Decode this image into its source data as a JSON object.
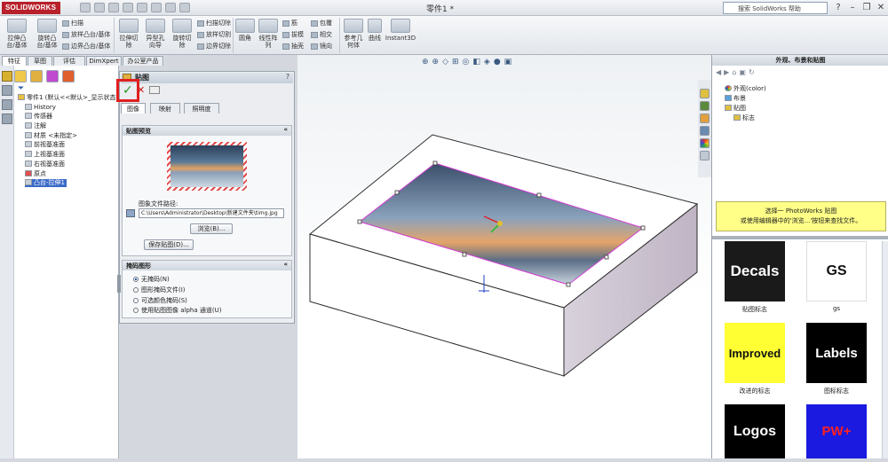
{
  "app": {
    "logo": "SOLIDWORKS",
    "doc_title": "零件1 *",
    "search_placeholder": "搜索 SolidWorks 帮助"
  },
  "ribbon": {
    "extrude_boss": "拉伸凸\n台/基体",
    "revolve_boss": "旋转凸\n台/基体",
    "sweep": "扫描",
    "loft": "放样凸台/基体",
    "boundary_boss": "边界凸台/基体",
    "extrude_cut": "拉伸切\n除",
    "hole_wizard": "异型孔\n向导",
    "revolve_cut": "旋转切\n除",
    "sweep_cut": "扫描切除",
    "loft_cut": "放样切割",
    "boundary_cut": "边界切除",
    "fillet": "圆角",
    "linear_pattern": "线性阵\n列",
    "rib": "筋",
    "draft": "拔模",
    "shell": "抽壳",
    "wrap": "包覆",
    "intersect": "相交",
    "mirror": "镜向",
    "ref_geometry": "参考几\n何体",
    "curves": "曲线",
    "instant3d": "Instant3D"
  },
  "tabs": [
    "特征",
    "草图",
    "评估",
    "DimXpert",
    "办公室产品"
  ],
  "tree": {
    "root": "零件1 (默认<<默认>_显示状态",
    "items": [
      "History",
      "传感器",
      "注解",
      "材质 <未指定>",
      "前视基准面",
      "上视基准面",
      "右视基准面",
      "原点",
      "凸台-拉伸1"
    ]
  },
  "pm": {
    "title": "贴图",
    "tabs": [
      "图像",
      "映射",
      "照明度"
    ],
    "preview_header": "贴图预览",
    "path_label": "图象文件路径:",
    "path_value": "C:\\Users\\Administrator\\Desktop\\新建文件夹\\timg.jpg",
    "browse": "浏览(B)...",
    "save": "保存贴图(D)...",
    "mask_header": "掩码图形",
    "mask_options": [
      "无掩码(N)",
      "图形掩码文件(I)",
      "可选颜色掩码(S)",
      "使用贴图图像 alpha 通道(U)"
    ]
  },
  "taskpane": {
    "title": "外观、布景和贴图",
    "tree": [
      "外观(color)",
      "布景",
      "贴图",
      "标志"
    ],
    "hint1": "选择一 PhotoWorks 贴图",
    "hint2": "或使用编辑器中的'浏览...'按钮来查找文件。",
    "decals": [
      {
        "art": "Decals",
        "label": "贴图标志"
      },
      {
        "art": "GS",
        "label": "gs"
      },
      {
        "art": "Improved",
        "label": "改进的标志"
      },
      {
        "art": "Labels",
        "label": "图标标志"
      },
      {
        "art": "Logos",
        "label": ""
      },
      {
        "art": "PW+",
        "label": ""
      }
    ]
  },
  "colors": {
    "sw_red": "#b8202a",
    "highlight": "#e02020",
    "yellow": "#ffff33",
    "blue_tile": "#1a1ae0"
  }
}
